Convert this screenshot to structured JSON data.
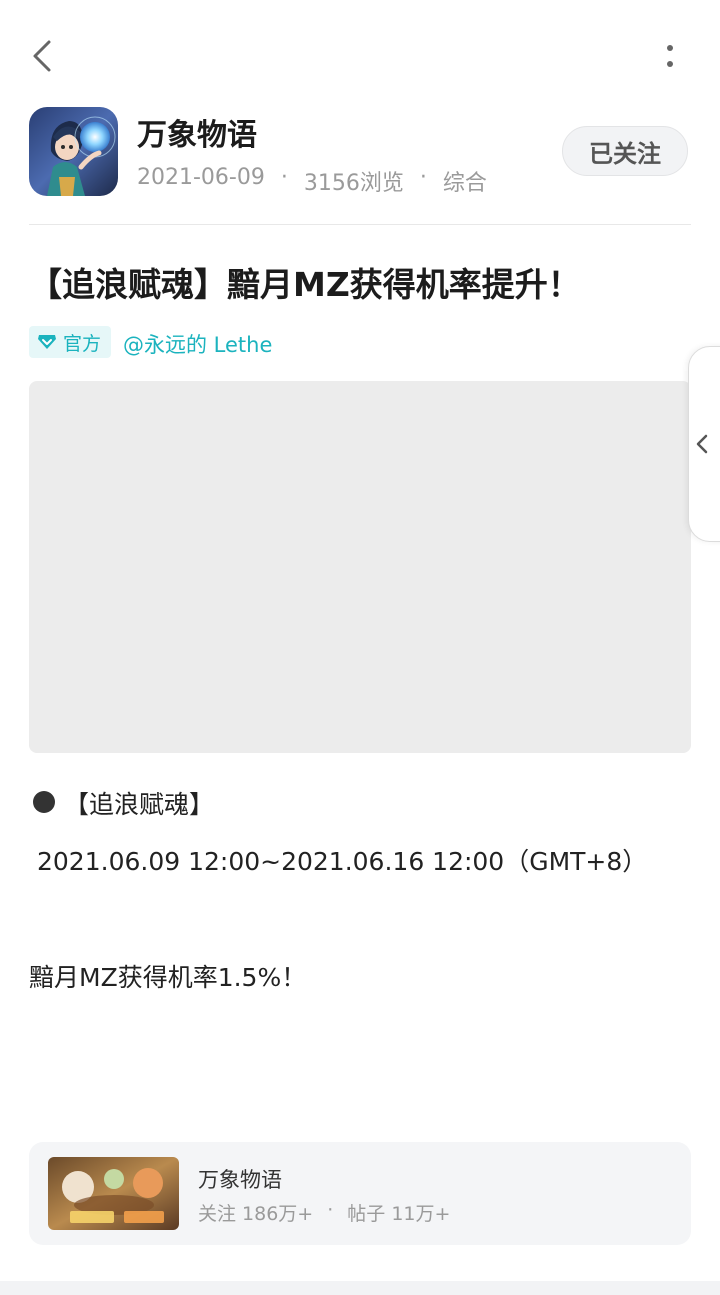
{
  "topbar": {
    "back_icon": "chevron-left-icon",
    "more_icon": "vertical-dots-icon"
  },
  "header": {
    "app_name": "万象物语",
    "date": "2021-06-09",
    "views": "3156浏览",
    "category": "综合",
    "separator": "·",
    "follow_label": "已关注"
  },
  "post": {
    "title": "【追浪赋魂】黯月MZ获得机率提升！",
    "official_badge": "官方",
    "author": "@永远的  Lethe",
    "section_heading": "【追浪赋魂】",
    "time_range": "2021.06.09 12:00~2021.06.16 12:00（GMT+8）",
    "body": "黯月MZ获得机率1.5%！"
  },
  "game_card": {
    "name": "万象物语",
    "followers": "关注 186万+",
    "separator": "·",
    "posts": "帖子 11万+"
  },
  "colors": {
    "accent": "#1bb3be",
    "badge_bg": "#e6f7f8",
    "placeholder": "#ececec",
    "card_bg": "#f4f5f7"
  }
}
